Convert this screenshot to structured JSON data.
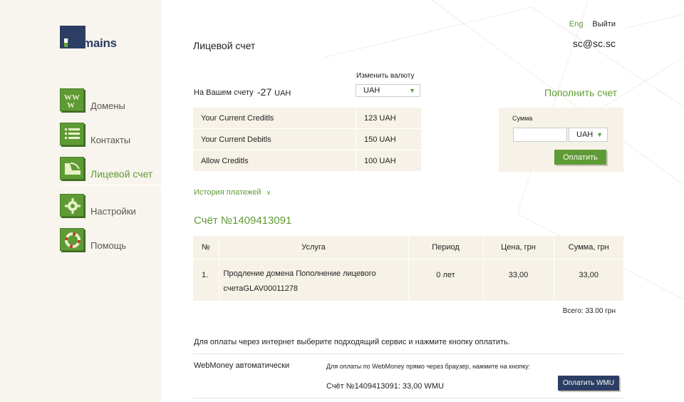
{
  "logo": {
    "text": "Domains"
  },
  "sidebar": {
    "items": [
      {
        "label": "Домены",
        "icon": "www-icon"
      },
      {
        "label": "Контакты",
        "icon": "contacts-list-icon"
      },
      {
        "label": "Лицевой счет",
        "icon": "account-icon",
        "active": true
      },
      {
        "label": "Настройки",
        "icon": "gear-icon"
      },
      {
        "label": "Помощь",
        "icon": "lifebuoy-icon"
      }
    ]
  },
  "header": {
    "lang_link": "Eng",
    "logout_link": "Выйти",
    "email": "sc@sc.sc"
  },
  "page": {
    "title": "Лицевой счет"
  },
  "balance": {
    "label": "На Вашем счету",
    "value": "-27",
    "unit": "UAH",
    "change_currency_label": "Изменить валюту",
    "currency_selected": "UAH"
  },
  "credits": [
    {
      "label": "Your Current Creditls",
      "value": "123 UAH"
    },
    {
      "label": "Your Current Debitls",
      "value": "150 UAH"
    },
    {
      "label": "Allow Creditls",
      "value": "100 UAH"
    }
  ],
  "topup": {
    "title": "Пополнить счет",
    "sum_label": "Сумма",
    "sum_value": "",
    "currency_selected": "UAH",
    "button": "Оплатить"
  },
  "history_link": "История платежей",
  "invoice": {
    "title": "Счёт №1409413091",
    "columns": [
      "№",
      "Услуга",
      "Период",
      "Цена, грн",
      "Сумма, грн"
    ],
    "rows": [
      {
        "num": "1.",
        "service_line1": "Продление домена Пополнение лицевого",
        "service_line2": "счетаGLAV00011278",
        "period": "0 лет",
        "price": "33,00",
        "sum": "33,00"
      }
    ],
    "total": "Всего: 33.00 грн"
  },
  "payment": {
    "note": "Для оплаты через интернет выберите подходящий сервис и нажмите кнопку оплатить.",
    "webmoney_label": "WebMoney автоматически",
    "webmoney_note": "Для оплаты по WebMoney прямо через браузер, нажмите на кнопку:",
    "webmoney_invoice": "Счёт №1409413091: 33,00 WMU",
    "webmoney_button": "Оплатить WMU"
  },
  "colors": {
    "accent_green": "#5f9b35",
    "navy": "#2c3e63",
    "panel_beige": "#f6f2e8",
    "sidebar_bg": "#f8f5ee"
  }
}
